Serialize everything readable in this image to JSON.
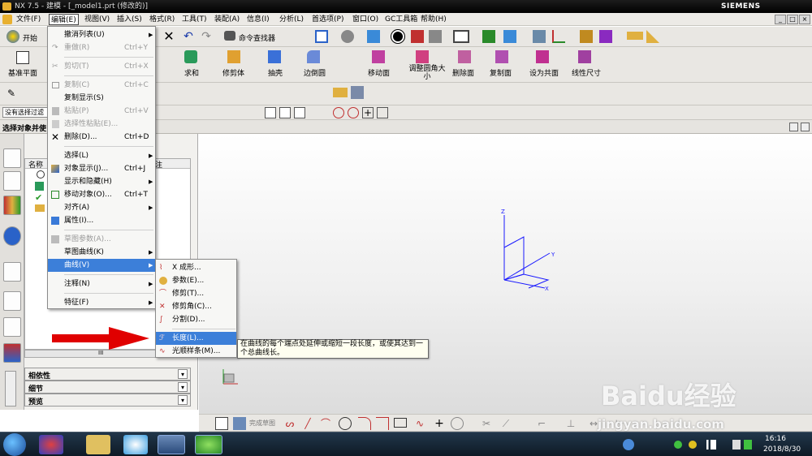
{
  "window": {
    "title": "NX 7.5 - 建模 - [_model1.prt (修改的)]",
    "brand": "SIEMENS",
    "min": "_",
    "restore": "□",
    "close": "×"
  },
  "menubar": [
    "文件(F)",
    "编辑(E)",
    "视图(V)",
    "插入(S)",
    "格式(R)",
    "工具(T)",
    "装配(A)",
    "信息(I)",
    "分析(L)",
    "首选项(P)",
    "窗口(O)",
    "GC工具箱",
    "帮助(H)"
  ],
  "toolbar": {
    "start": "开始",
    "command_finder": "命令查找器",
    "datum_plane": "基准平面",
    "sum": "求和",
    "trim_body": "修剪体",
    "shell": "抽壳",
    "edge_blend": "边倒圆",
    "move_face": "移动面",
    "resize_blend": "调整圆角大小",
    "delete_face": "删除面",
    "copy_face": "复制面",
    "make_coplanar": "设为共面",
    "linear_dim": "线性尺寸",
    "filter_value": "没有选择过滤",
    "complete_sketch": "完成草图"
  },
  "status_prompt": "选择对象并使",
  "navigator": {
    "col_name": "名称",
    "col_extra": "注",
    "sections": [
      "相依性",
      "细节",
      "预览"
    ],
    "scroll_mid": "III"
  },
  "edit_menu": {
    "items": [
      {
        "label": "撤消列表(U)",
        "shortcut": "",
        "arrow": true,
        "disabled": false
      },
      {
        "label": "重做(R)",
        "shortcut": "Ctrl+Y",
        "arrow": false,
        "disabled": true
      },
      {
        "label": "剪切(T)",
        "shortcut": "Ctrl+X",
        "arrow": false,
        "disabled": true
      },
      {
        "label": "复制(C)",
        "shortcut": "Ctrl+C",
        "arrow": false,
        "disabled": true
      },
      {
        "label": "复制显示(S)",
        "shortcut": "",
        "arrow": false,
        "disabled": false
      },
      {
        "label": "粘贴(P)",
        "shortcut": "Ctrl+V",
        "arrow": false,
        "disabled": true
      },
      {
        "label": "选择性粘贴(E)...",
        "shortcut": "",
        "arrow": false,
        "disabled": true
      },
      {
        "label": "删除(D)...",
        "shortcut": "Ctrl+D",
        "arrow": false,
        "disabled": false
      },
      {
        "label": "选择(L)",
        "shortcut": "",
        "arrow": true,
        "disabled": false
      },
      {
        "label": "对象显示(J)...",
        "shortcut": "Ctrl+J",
        "arrow": false,
        "disabled": false
      },
      {
        "label": "显示和隐藏(H)",
        "shortcut": "",
        "arrow": true,
        "disabled": false
      },
      {
        "label": "移动对象(O)...",
        "shortcut": "Ctrl+T",
        "arrow": false,
        "disabled": false
      },
      {
        "label": "对齐(A)",
        "shortcut": "",
        "arrow": true,
        "disabled": false
      },
      {
        "label": "属性(I)...",
        "shortcut": "",
        "arrow": false,
        "disabled": false
      },
      {
        "label": "草图参数(A)...",
        "shortcut": "",
        "arrow": false,
        "disabled": true
      },
      {
        "label": "草图曲线(K)",
        "shortcut": "",
        "arrow": true,
        "disabled": false
      },
      {
        "label": "曲线(V)",
        "shortcut": "",
        "arrow": true,
        "disabled": false,
        "highlighted": true
      },
      {
        "label": "注释(N)",
        "shortcut": "",
        "arrow": true,
        "disabled": false
      },
      {
        "label": "特征(F)",
        "shortcut": "",
        "arrow": true,
        "disabled": false
      }
    ]
  },
  "curve_submenu": {
    "items": [
      {
        "label": "X 成形..."
      },
      {
        "label": "参数(E)..."
      },
      {
        "label": "修剪(T)..."
      },
      {
        "label": "修剪角(C)..."
      },
      {
        "label": "分割(D)..."
      },
      {
        "label": "长度(L)...",
        "highlighted": true
      },
      {
        "label": "光顺样条(M)..."
      }
    ]
  },
  "tooltip": "在曲线的每个端点处延伸或缩短一段长度，或使其达到一个总曲线长。",
  "axes": {
    "x": "X",
    "y": "Y",
    "z": "Z"
  },
  "taskbar": {
    "time": "16:16",
    "date": "2018/8/30"
  },
  "watermark": {
    "brand": "Baidu经验",
    "url": "jingyan.baidu.com"
  },
  "colors": {
    "highlight": "#3c7fd9",
    "axis": "#1a1aff",
    "arrow": "#e00000"
  }
}
